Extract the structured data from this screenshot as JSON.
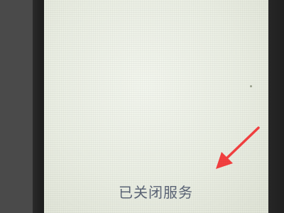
{
  "screen": {
    "status_text": "已关闭服务"
  },
  "annotation": {
    "icon": "red-arrow-icon",
    "color": "#f44040"
  },
  "colors": {
    "screen_background": "#eef1e8",
    "status_text": "#5b6476",
    "bezel": "#1e1e1e"
  }
}
